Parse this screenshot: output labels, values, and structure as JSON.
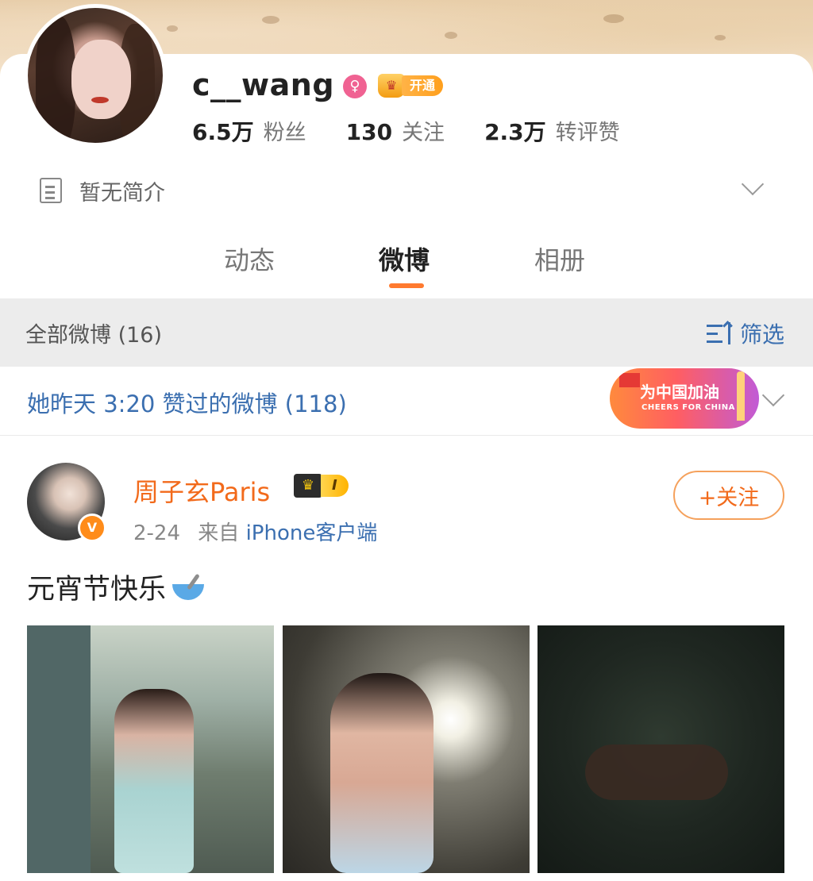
{
  "profile": {
    "username": "c__wang",
    "vip_label": "开通",
    "stats": [
      {
        "num": "6.5万",
        "label": "粉丝"
      },
      {
        "num": "130",
        "label": "关注"
      },
      {
        "num": "2.3万",
        "label": "转评赞"
      }
    ],
    "bio": "暂无简介"
  },
  "tabs": [
    {
      "label": "动态",
      "active": false
    },
    {
      "label": "微博",
      "active": true
    },
    {
      "label": "相册",
      "active": false
    }
  ],
  "filter_bar": {
    "all_label": "全部微博 (16)",
    "filter_label": "筛选"
  },
  "liked": {
    "text": "她昨天 3:20 赞过的微博 (118)",
    "badge_title": "为中国加油",
    "badge_subtitle": "CHEERS FOR CHINA"
  },
  "post": {
    "author": "周子玄Paris",
    "vip_level": "I",
    "date": "2-24",
    "from_label": "来自",
    "source": "iPhone客户端",
    "follow_label": "+关注",
    "verify_mark": "V",
    "text": "元宵节快乐"
  },
  "colors": {
    "accent_orange": "#f26a1b",
    "link_blue": "#3b6fb0",
    "tab_indicator": "#ff7a2f"
  }
}
